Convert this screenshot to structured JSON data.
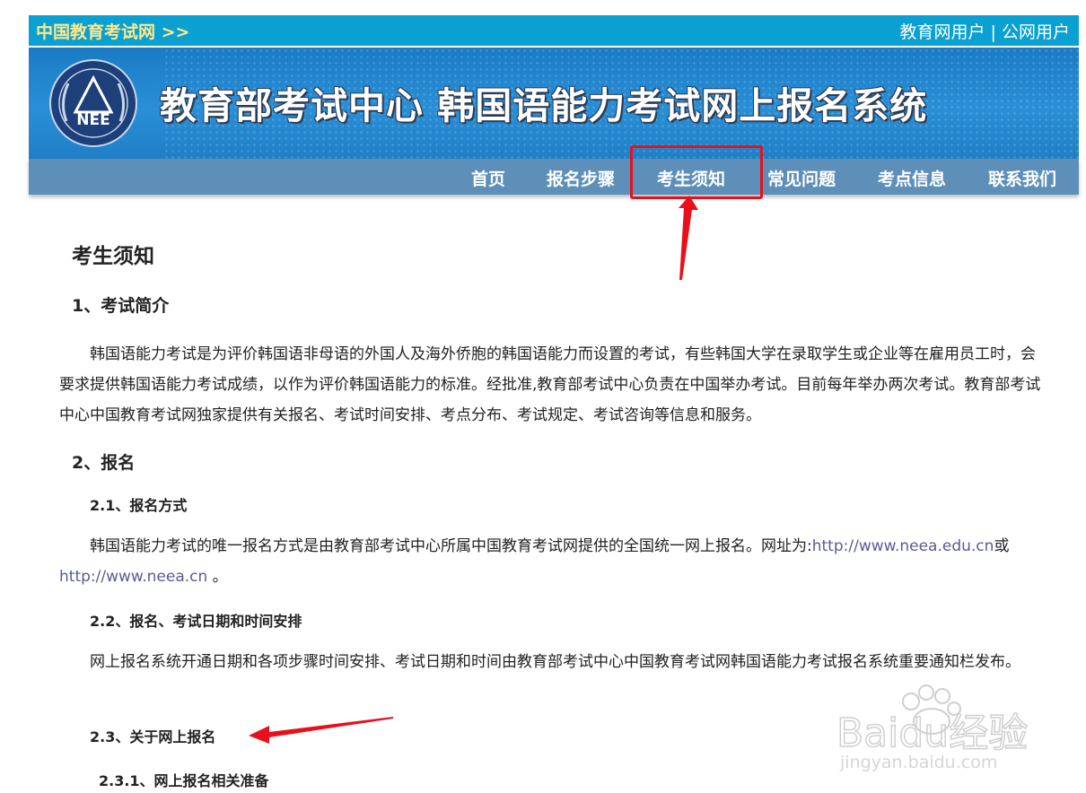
{
  "topbar": {
    "home_link": "中国教育考试网 >>",
    "user_edu": "教育网用户",
    "separator": " | ",
    "user_public": "公网用户"
  },
  "banner": {
    "logo_text": "NEE",
    "title": "教育部考试中心  韩国语能力考试网上报名系统"
  },
  "nav": {
    "items": [
      "首页",
      "报名步骤",
      "考生须知",
      "常见问题",
      "考点信息",
      "联系我们"
    ],
    "active": "考生须知"
  },
  "content": {
    "title": "考生须知",
    "s1_heading": "1、考试简介",
    "s1_text": "韩国语能力考试是为评价韩国语非母语的外国人及海外侨胞的韩国语能力而设置的考试，有些韩国大学在录取学生或企业等在雇用员工时，会要求提供韩国语能力考试成绩，以作为评价韩国语能力的标准。经批准,教育部考试中心负责在中国举办考试。目前每年举办两次考试。教育部考试中心中国教育考试网独家提供有关报名、考试时间安排、考点分布、考试规定、考试咨询等信息和服务。",
    "s2_heading": "2、报名",
    "s21_heading": "2.1、报名方式",
    "s21_text": "韩国语能力考试的唯一报名方式是由教育部考试中心所属中国教育考试网提供的全国统一网上报名。网址为:",
    "s21_link1": "http://www.neea.edu.cn",
    "s21_or": "或",
    "s21_link2": "http://www.neea.cn",
    "s21_end": " 。",
    "s22_heading": "2.2、报名、考试日期和时间安排",
    "s22_text": "网上报名系统开通日期和各项步骤时间安排、考试日期和时间由教育部考试中心中国教育考试网韩国语能力考试报名系统重要通知栏发布。",
    "s23_heading": "2.3、关于网上报名",
    "s231_heading": "2.3.1、网上报名相关准备"
  },
  "watermark": {
    "brand": "Baidu经验",
    "url": "jingyan.baidu.com"
  },
  "colors": {
    "topbar": "#0aa0d2",
    "nav": "#5d8fb9",
    "annotation": "#e8101a",
    "link": "#5a5a9a"
  }
}
